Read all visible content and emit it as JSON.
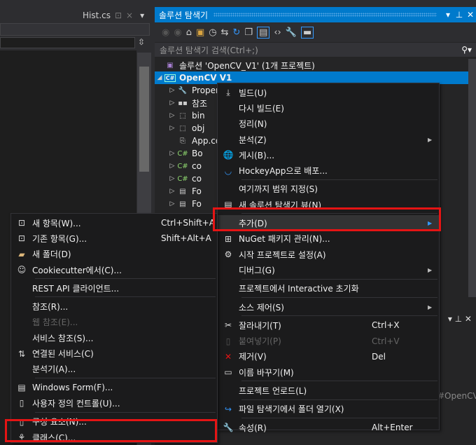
{
  "editor": {
    "tab": "Hist.cs",
    "tab_pin": "⊡",
    "tab_close": "×",
    "tab_dropdown": "▾"
  },
  "solution_explorer": {
    "title": "솔루션 탐색기",
    "title_buttons": [
      "▾",
      "ㅁ",
      "✕"
    ],
    "search_placeholder": "솔루션 탐색기 검색(Ctrl+;)",
    "solution": "솔루션 'OpenCV_V1' (1개 프로젝트)",
    "project": "OpenCV V1",
    "tree": [
      {
        "label": "Properties",
        "icon": "wrench-icon"
      },
      {
        "label": "참조",
        "icon": "references-icon"
      },
      {
        "label": "bin",
        "icon": "folder-icon"
      },
      {
        "label": "obj",
        "icon": "folder-icon"
      },
      {
        "label": "App.config",
        "icon": "config-icon"
      },
      {
        "label": "Bo",
        "icon": "csharp-icon"
      },
      {
        "label": "co",
        "icon": "csharp-icon"
      },
      {
        "label": "co",
        "icon": "csharp-icon"
      },
      {
        "label": "Fo",
        "icon": "form-icon"
      },
      {
        "label": "Fo",
        "icon": "form-icon"
      }
    ]
  },
  "lower_panel": {
    "path_fragment": "#OpenCV"
  },
  "context_menu": [
    {
      "label": "빌드(U)",
      "icon": "build-icon"
    },
    {
      "label": "다시 빌드(E)"
    },
    {
      "label": "정리(N)"
    },
    {
      "label": "분석(Z)",
      "submenu": true
    },
    {
      "label": "게시(B)...",
      "icon": "publish-globe-icon"
    },
    {
      "label": "HockeyApp으로 배포...",
      "icon": "hockeyapp-icon"
    },
    {
      "sep": true
    },
    {
      "label": "여기까지 범위 지정(S)"
    },
    {
      "label": "새 솔루션 탐색기 뷰(N)",
      "icon": "new-view-icon"
    },
    {
      "sep": true
    },
    {
      "label": "추가(D)",
      "submenu": true,
      "highlighted": true
    },
    {
      "label": "NuGet 패키지 관리(N)...",
      "icon": "nuget-icon"
    },
    {
      "label": "시작 프로젝트로 설정(A)",
      "icon": "gear-icon"
    },
    {
      "label": "디버그(G)",
      "submenu": true
    },
    {
      "sep": true
    },
    {
      "label": "프로젝트에서 Interactive 초기화"
    },
    {
      "sep": true
    },
    {
      "label": "소스 제어(S)",
      "submenu": true
    },
    {
      "sep": true
    },
    {
      "label": "잘라내기(T)",
      "icon": "scissors-icon",
      "shortcut": "Ctrl+X"
    },
    {
      "label": "붙여넣기(P)",
      "icon": "paste-icon",
      "shortcut": "Ctrl+V",
      "disabled": true
    },
    {
      "label": "제거(V)",
      "icon": "remove-x-icon",
      "shortcut": "Del"
    },
    {
      "label": "이름 바꾸기(M)",
      "icon": "rename-icon"
    },
    {
      "sep": true
    },
    {
      "label": "프로젝트 언로드(L)"
    },
    {
      "sep": true
    },
    {
      "label": "파일 탐색기에서 폴더 열기(X)",
      "icon": "open-folder-arrow-icon"
    },
    {
      "sep": true
    },
    {
      "label": "속성(R)",
      "icon": "wrench-icon",
      "shortcut": "Alt+Enter"
    }
  ],
  "add_submenu": [
    {
      "label": "새 항목(W)...",
      "icon": "new-item-icon",
      "shortcut": "Ctrl+Shift+A"
    },
    {
      "label": "기존 항목(G)...",
      "icon": "existing-item-icon",
      "shortcut": "Shift+Alt+A"
    },
    {
      "label": "새 폴더(D)",
      "icon": "new-folder-icon"
    },
    {
      "label": "Cookiecutter에서(C)...",
      "icon": "cookiecutter-icon"
    },
    {
      "sep": true
    },
    {
      "label": "REST API 클라이언트..."
    },
    {
      "sep": true
    },
    {
      "label": "참조(R)..."
    },
    {
      "label": "웹 참조(E)...",
      "disabled": true
    },
    {
      "label": "서비스 참조(S)..."
    },
    {
      "label": "연결된 서비스(C)",
      "icon": "connected-service-icon"
    },
    {
      "label": "분석기(A)..."
    },
    {
      "sep": true
    },
    {
      "label": "Windows Form(F)...",
      "icon": "windows-form-icon"
    },
    {
      "label": "사용자 정의 컨트롤(U)...",
      "icon": "user-control-icon"
    },
    {
      "sep": true
    },
    {
      "label": "구성 요소(N)...",
      "icon": "component-icon"
    },
    {
      "label": "클래스(C)...",
      "icon": "class-icon",
      "boxed": true
    }
  ],
  "colors": {
    "accent": "#007acc",
    "highlight_box": "#e51414",
    "menu_bg": "#1b1b1c"
  }
}
